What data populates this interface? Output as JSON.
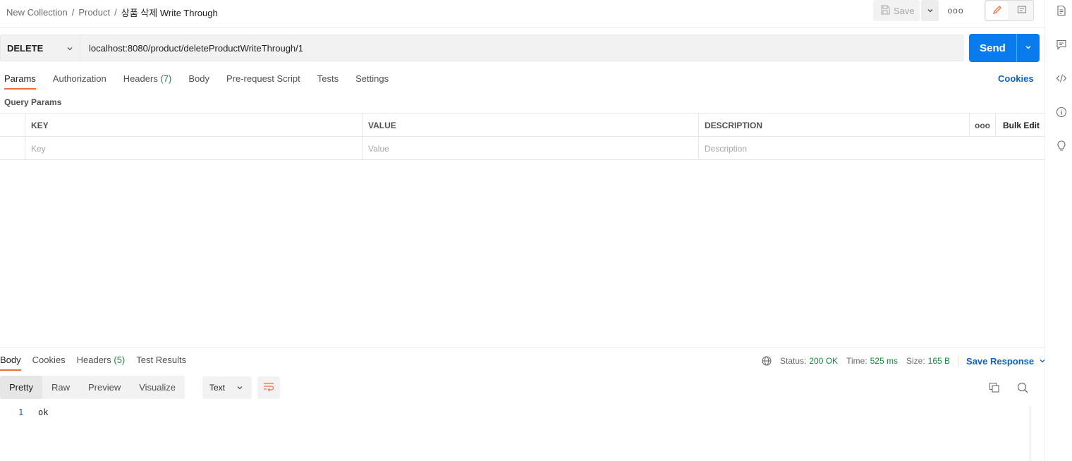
{
  "breadcrumb": {
    "collection": "New Collection",
    "sep1": "/",
    "folder": "Product",
    "sep2": "/",
    "request": "상품 삭제 Write Through"
  },
  "header": {
    "save_label": "Save",
    "more_label": "ooo"
  },
  "request": {
    "method": "DELETE",
    "url": "localhost:8080/product/deleteProductWriteThrough/1",
    "send_label": "Send"
  },
  "req_tabs": {
    "params": "Params",
    "authorization": "Authorization",
    "headers": "Headers",
    "headers_count": "(7)",
    "body": "Body",
    "prerequest": "Pre-request Script",
    "tests": "Tests",
    "settings": "Settings",
    "cookies": "Cookies"
  },
  "query_params": {
    "title": "Query Params",
    "columns": {
      "key": "KEY",
      "value": "VALUE",
      "description": "DESCRIPTION",
      "more": "ooo",
      "bulk_edit": "Bulk Edit"
    },
    "placeholders": {
      "key": "Key",
      "value": "Value",
      "description": "Description"
    }
  },
  "response": {
    "tabs": {
      "body": "Body",
      "cookies": "Cookies",
      "headers": "Headers",
      "headers_count": "(5)",
      "test_results": "Test Results"
    },
    "status_label": "Status:",
    "status_value": "200 OK",
    "time_label": "Time:",
    "time_value": "525 ms",
    "size_label": "Size:",
    "size_value": "165 B",
    "save_response": "Save Response",
    "formats": {
      "pretty": "Pretty",
      "raw": "Raw",
      "preview": "Preview",
      "visualize": "Visualize"
    },
    "language": "Text",
    "line_number": "1",
    "line_text": "ok"
  },
  "colors": {
    "accent": "#f26b3a",
    "send": "#097bed",
    "link": "#0b63c5",
    "success": "#0f8c3b"
  }
}
